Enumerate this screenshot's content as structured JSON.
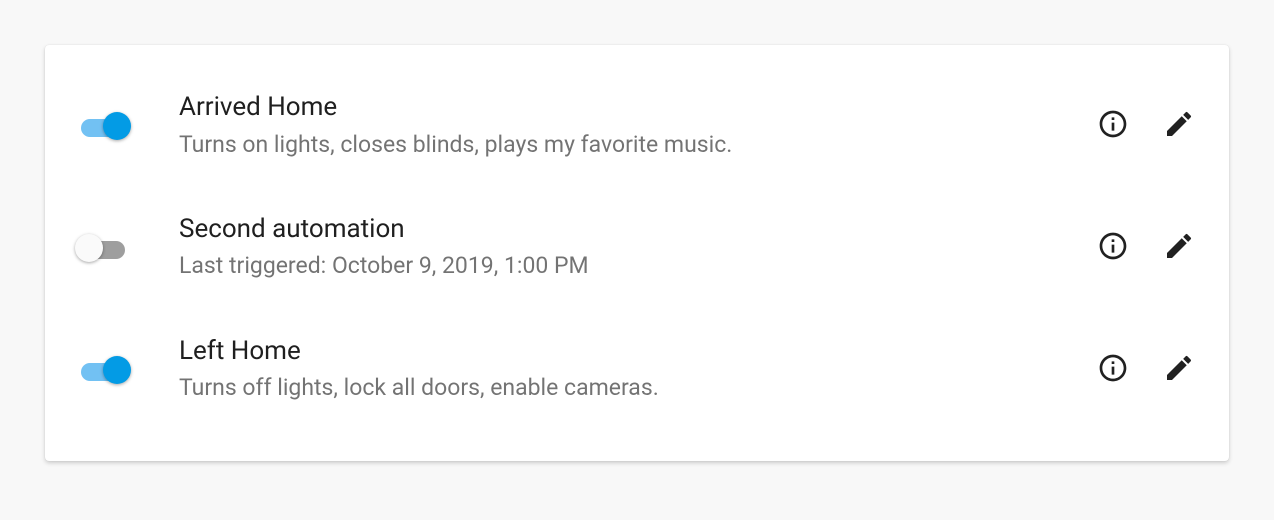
{
  "automations": [
    {
      "enabled": true,
      "title": "Arrived Home",
      "subtitle": "Turns on lights, closes blinds, plays my favorite music."
    },
    {
      "enabled": false,
      "title": "Second automation",
      "subtitle": "Last triggered: October 9, 2019, 1:00 PM"
    },
    {
      "enabled": true,
      "title": "Left Home",
      "subtitle": "Turns off lights, lock all doors, enable cameras."
    }
  ],
  "icons": {
    "info": "info-icon",
    "edit": "pencil-icon"
  }
}
